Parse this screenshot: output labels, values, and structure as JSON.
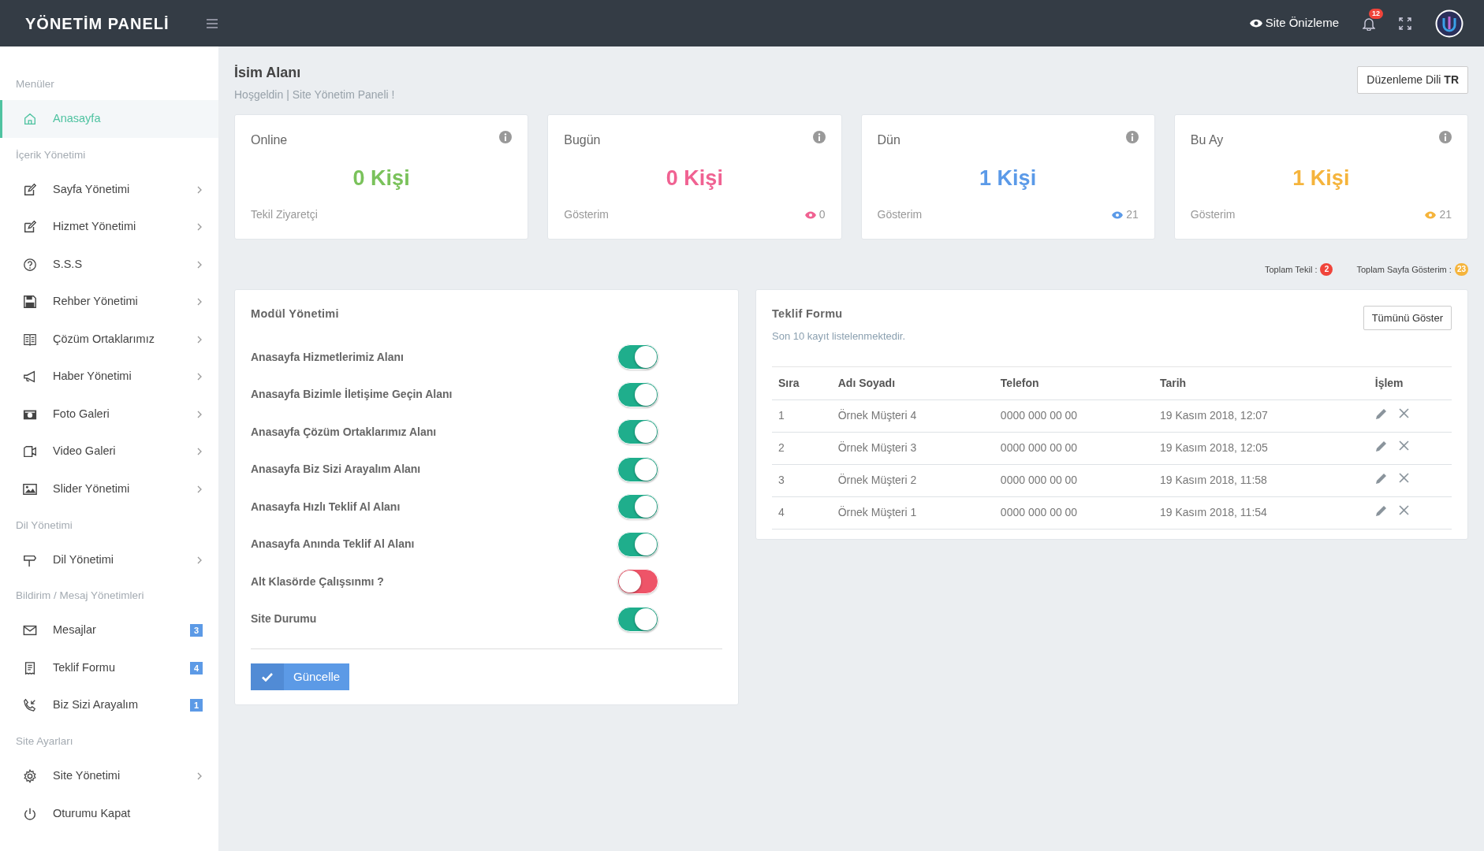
{
  "topbar": {
    "brand": "YÖNETİM PANELİ",
    "preview": "Site Önizleme",
    "notification_count": "12"
  },
  "sidebar": {
    "items": [
      {
        "kind": "header",
        "label": "Menüler"
      },
      {
        "kind": "item",
        "label": "Anasayfa",
        "selected": true,
        "submenu": false
      },
      {
        "kind": "header",
        "label": "İçerik Yönetimi"
      },
      {
        "kind": "item",
        "label": "Sayfa Yönetimi",
        "selected": false,
        "submenu": true
      },
      {
        "kind": "item",
        "label": "Hizmet Yönetimi",
        "selected": false,
        "submenu": true
      },
      {
        "kind": "item",
        "label": "S.S.S",
        "selected": false,
        "submenu": true
      },
      {
        "kind": "item",
        "label": "Rehber Yönetimi",
        "selected": false,
        "submenu": true
      },
      {
        "kind": "item",
        "label": "Çözüm Ortaklarımız",
        "selected": false,
        "submenu": true
      },
      {
        "kind": "item",
        "label": "Haber Yönetimi",
        "selected": false,
        "submenu": true
      },
      {
        "kind": "item",
        "label": "Foto Galeri",
        "selected": false,
        "submenu": true
      },
      {
        "kind": "item",
        "label": "Video Galeri",
        "selected": false,
        "submenu": true
      },
      {
        "kind": "item",
        "label": "Slider Yönetimi",
        "selected": false,
        "submenu": true
      },
      {
        "kind": "header",
        "label": "Dil Yönetimi"
      },
      {
        "kind": "item",
        "label": "Dil Yönetimi",
        "selected": false,
        "submenu": true
      },
      {
        "kind": "header",
        "label": "Bildirim / Mesaj Yönetimleri"
      },
      {
        "kind": "item",
        "label": "Mesajlar",
        "selected": false,
        "submenu": false,
        "badge": "3"
      },
      {
        "kind": "item",
        "label": "Teklif Formu",
        "selected": false,
        "submenu": false,
        "badge": "4"
      },
      {
        "kind": "item",
        "label": "Biz Sizi Arayalım",
        "selected": false,
        "submenu": false,
        "badge": "1"
      },
      {
        "kind": "header",
        "label": "Site Ayarları"
      },
      {
        "kind": "item",
        "label": "Site Yönetimi",
        "selected": false,
        "submenu": true
      },
      {
        "kind": "item",
        "label": "Oturumu Kapat",
        "selected": false,
        "submenu": false
      }
    ]
  },
  "page": {
    "title": "İsim Alanı",
    "breadcrumb": "Hoşgeldin | Site Yönetim Paneli !",
    "language_button": "Düzenleme Dili **TR**"
  },
  "stats": [
    {
      "title": "Online",
      "value": "0 Kişi",
      "color": "#7ac25b",
      "footer": "Tekil Ziyaretçi"
    },
    {
      "title": "Bugün",
      "value": "0 Kişi",
      "color": "#f06292",
      "footer": "Gösterim",
      "views": "0"
    },
    {
      "title": "Dün",
      "value": "1 Kişi",
      "color": "#5b9ae8",
      "footer": "Gösterim",
      "views": "21"
    },
    {
      "title": "Bu Ay",
      "value": "1 Kişi",
      "color": "#f5b43c",
      "footer": "Gösterim",
      "views": "21"
    }
  ],
  "totals": [
    {
      "label": "Toplam Tekil :",
      "count": "2",
      "color": "#f0443a"
    },
    {
      "label": "Toplam Sayfa Gösterim :",
      "count": "23",
      "color": "#f5b43c"
    }
  ],
  "modules": {
    "title": "Modül Yönetimi",
    "items": [
      {
        "label": "Anasayfa Hizmetlerimiz Alanı",
        "on": true
      },
      {
        "label": "Anasayfa Bizimle İletişime Geçin Alanı",
        "on": true
      },
      {
        "label": "Anasayfa Çözüm Ortaklarımız Alanı",
        "on": true
      },
      {
        "label": "Anasayfa Biz Sizi Arayalım Alanı",
        "on": true
      },
      {
        "label": "Anasayfa Hızlı Teklif Al Alanı",
        "on": true
      },
      {
        "label": "Anasayfa Anında Teklif Al Alanı",
        "on": true
      },
      {
        "label": "Alt Klasörde Çalışsınmı ?",
        "on": false
      },
      {
        "label": "Site Durumu",
        "on": true
      }
    ],
    "button": "Güncelle"
  },
  "offers": {
    "title": "Teklif Formu",
    "subtitle": "Son 10 kayıt listelenmektedir.",
    "button": "Tümünü Göster",
    "columns": [
      "Sıra",
      "Adı Soyadı",
      "Telefon",
      "Tarih",
      "İşlem"
    ],
    "rows": [
      [
        "1",
        "Örnek Müşteri 4",
        "0000 000 00 00",
        "19 Kasım 2018, 12:07"
      ],
      [
        "2",
        "Örnek Müşteri 3",
        "0000 000 00 00",
        "19 Kasım 2018, 12:05"
      ],
      [
        "3",
        "Örnek Müşteri 2",
        "0000 000 00 00",
        "19 Kasım 2018, 11:58"
      ],
      [
        "4",
        "Örnek Müşteri 1",
        "0000 000 00 00",
        "19 Kasım 2018, 11:54"
      ]
    ]
  }
}
